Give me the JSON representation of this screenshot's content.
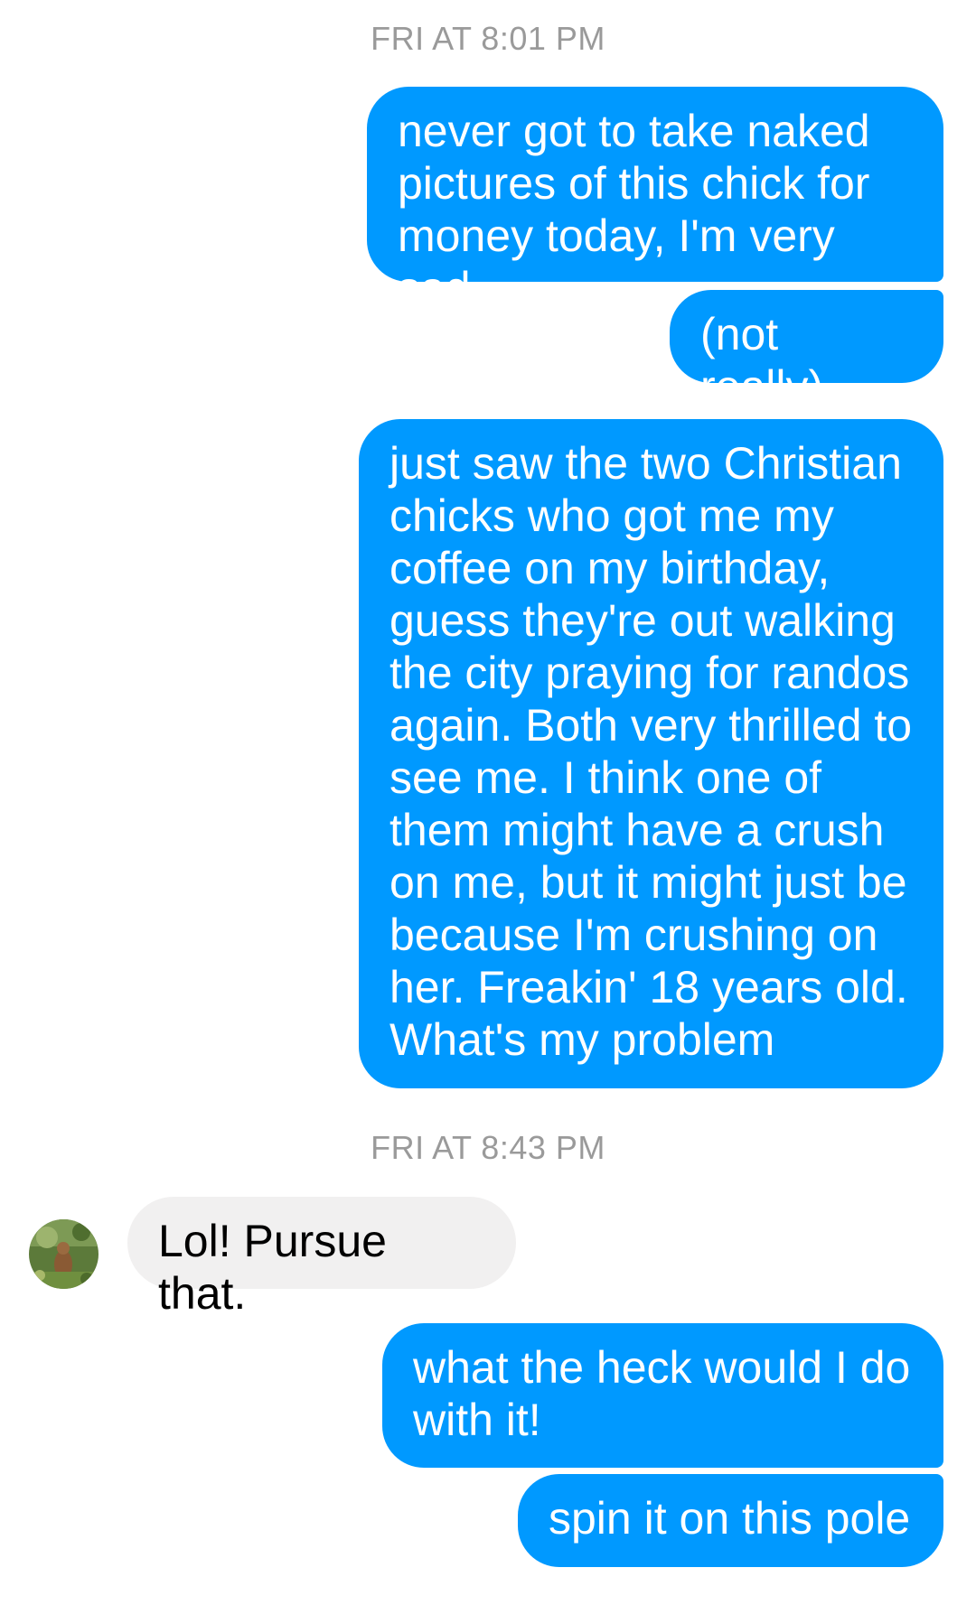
{
  "timestamps": [
    "FRI AT 8:01 PM",
    "FRI AT 8:43 PM"
  ],
  "messages": [
    {
      "sender": "me",
      "text": "never got to take naked\npictures of this chick for\nmoney today, I'm very sad"
    },
    {
      "sender": "me",
      "text": "(not really)"
    },
    {
      "sender": "me",
      "text": "just saw the two Christian\nchicks who got me my\ncoffee on my birthday,\nguess they're out walking\nthe city praying for randos\nagain. Both very thrilled to\nsee me. I think one of\nthem might have a crush\non me, but it might just be\nbecause I'm crushing on\nher. Freakin' 18 years old.\nWhat's my problem"
    },
    {
      "sender": "them",
      "text": "Lol! Pursue that."
    },
    {
      "sender": "me",
      "text": "what the heck would I do\nwith it!"
    },
    {
      "sender": "me",
      "text": "spin it on this pole"
    }
  ],
  "colors": {
    "outgoing_bubble": "#0099ff",
    "incoming_bubble": "#f1f0f0",
    "timestamp_text": "#9a9a9a"
  }
}
